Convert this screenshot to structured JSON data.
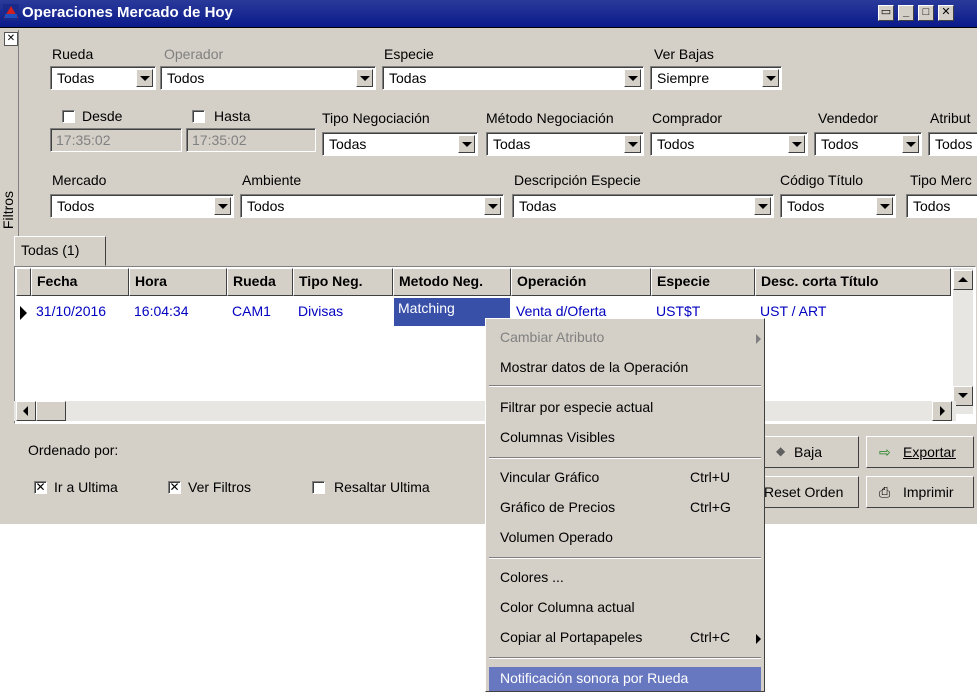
{
  "window": {
    "title": "Operaciones Mercado de Hoy",
    "buttons": [
      "–",
      "—",
      "□",
      "✕"
    ]
  },
  "filters": {
    "panel_label": "Filtros",
    "rueda": {
      "label": "Rueda",
      "value": "Todas"
    },
    "operador": {
      "label": "Operador",
      "value": "Todos"
    },
    "especie": {
      "label": "Especie",
      "value": "Todas"
    },
    "ver_bajas": {
      "label": "Ver Bajas",
      "value": "Siempre"
    },
    "desde": {
      "label": "Desde",
      "value": "17:35:02"
    },
    "hasta": {
      "label": "Hasta",
      "value": "17:35:02"
    },
    "tipo_negociacion": {
      "label": "Tipo Negociación",
      "value": "Todas"
    },
    "metodo_negociacion": {
      "label": "Método Negociación",
      "value": "Todas"
    },
    "comprador": {
      "label": "Comprador",
      "value": "Todos"
    },
    "vendedor": {
      "label": "Vendedor",
      "value": "Todos"
    },
    "atributo": {
      "label": "Atribut",
      "value": "Todos"
    },
    "mercado": {
      "label": "Mercado",
      "value": "Todos"
    },
    "ambiente": {
      "label": "Ambiente",
      "value": "Todos"
    },
    "descripcion_especie": {
      "label": "Descripción Especie",
      "value": "Todas"
    },
    "codigo_titulo": {
      "label": "Código Título",
      "value": "Todos"
    },
    "tipo_mercado": {
      "label": "Tipo Merc",
      "value": "Todos"
    }
  },
  "tab": {
    "label": "Todas (1)"
  },
  "grid": {
    "headers": [
      "Fecha",
      "Hora",
      "Rueda",
      "Tipo Neg.",
      "Metodo Neg.",
      "Operación",
      "Especie",
      "Desc. corta Título"
    ],
    "row": [
      "31/10/2016",
      "16:04:34",
      "CAM1",
      "Divisas",
      "Matching",
      "Venta d/Oferta",
      "UST$T",
      "UST / ART"
    ]
  },
  "bottom": {
    "ordenado_por": "Ordenado por:",
    "ir_a_ultima": {
      "label": "Ir a Ultima",
      "checked": true
    },
    "ver_filtros": {
      "label": "Ver Filtros",
      "checked": true
    },
    "resaltar_ultima": {
      "label": "Resaltar Ultima",
      "checked": false
    },
    "baja": "Baja",
    "exportar": "Exportar",
    "reset_orden": "Reset Orden",
    "imprimir": "Imprimir"
  },
  "context_menu": {
    "items": [
      {
        "label": "Cambiar Atributo",
        "disabled": true,
        "submenu": true
      },
      {
        "label": "Mostrar datos de la Operación"
      },
      {
        "label": "Filtrar por especie actual"
      },
      {
        "label": "Columnas Visibles"
      },
      {
        "label": "Vincular Gráfico",
        "shortcut": "Ctrl+U"
      },
      {
        "label": "Gráfico de Precios",
        "shortcut": "Ctrl+G"
      },
      {
        "label": "Volumen Operado"
      },
      {
        "label": "Colores ..."
      },
      {
        "label": "Color Columna actual"
      },
      {
        "label": "Copiar al Portapapeles",
        "shortcut": "Ctrl+C",
        "submenu": true
      },
      {
        "label": "Notificación sonora por Rueda",
        "highlighted": true
      }
    ]
  },
  "colors": {
    "titlebar": "#0a1a8a",
    "highlight": "#6878c0",
    "link_text": "#0000c0"
  }
}
